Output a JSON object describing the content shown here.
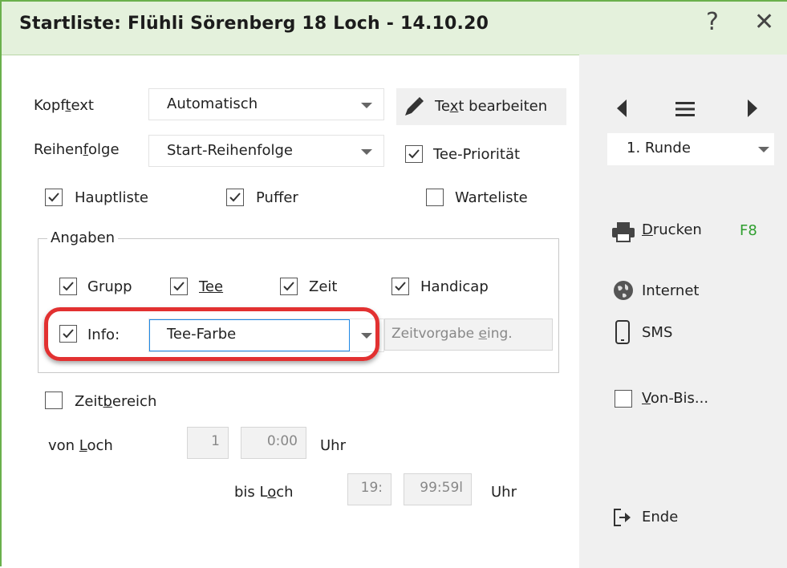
{
  "window": {
    "title": "Startliste: Flühli Sörenberg 18 Loch - 14.10.20",
    "help": "?",
    "close": "✕"
  },
  "kopftext": {
    "label_pre": "Kopf",
    "label_u": "t",
    "label_post": "ext",
    "value": "Automatisch"
  },
  "edit_text": {
    "pre": "Te",
    "u": "x",
    "post": "t bearbeiten"
  },
  "reihenfolge": {
    "label_pre": "Reihen",
    "label_u": "f",
    "label_post": "olge",
    "value": "Start-Reihenfolge"
  },
  "tee_prio": {
    "label": "Tee-Priorität",
    "checked": true
  },
  "hauptliste": {
    "label": "Hauptliste",
    "checked": true
  },
  "puffer": {
    "label": "Puffer",
    "checked": true
  },
  "warteliste": {
    "label": "Warteliste",
    "checked": false
  },
  "angaben": {
    "title": "Angaben",
    "grupp": {
      "label": "Grupp",
      "checked": true
    },
    "tee": {
      "label": "Tee",
      "checked": true
    },
    "zeit": {
      "label": "Zeit",
      "checked": true
    },
    "handicap": {
      "label": "Handicap",
      "checked": true
    },
    "info": {
      "label": "Info:",
      "checked": true,
      "value": "Tee-Farbe"
    },
    "zeitvorgabe": {
      "pre": "Zeitvorgabe ",
      "u": "e",
      "post": "ing."
    }
  },
  "zeitbereich": {
    "label_pre": "Zeit",
    "label_u": "b",
    "label_post": "ereich",
    "checked": false
  },
  "von_loch": {
    "label_pre": "von ",
    "label_u": "L",
    "label_post": "och",
    "hole": "1",
    "time": "0:00",
    "unit": "Uhr"
  },
  "bis_loch": {
    "label_pre": "bis L",
    "label_u": "o",
    "label_post": "ch",
    "hole": "19:",
    "time": "99:59l",
    "unit": "Uhr"
  },
  "side": {
    "runde": "1. Runde",
    "drucken": {
      "u": "D",
      "rest": "rucken",
      "shortcut": "F8"
    },
    "internet": "Internet",
    "sms": "SMS",
    "vonbis": {
      "u": "V",
      "rest": "on-Bis...",
      "checked": false
    },
    "ende": "Ende"
  },
  "colors": {
    "titlebar": "#e4f1dc",
    "border": "#6ab04c",
    "highlight": "#e23131",
    "shortcut": "#2e9e2e"
  }
}
